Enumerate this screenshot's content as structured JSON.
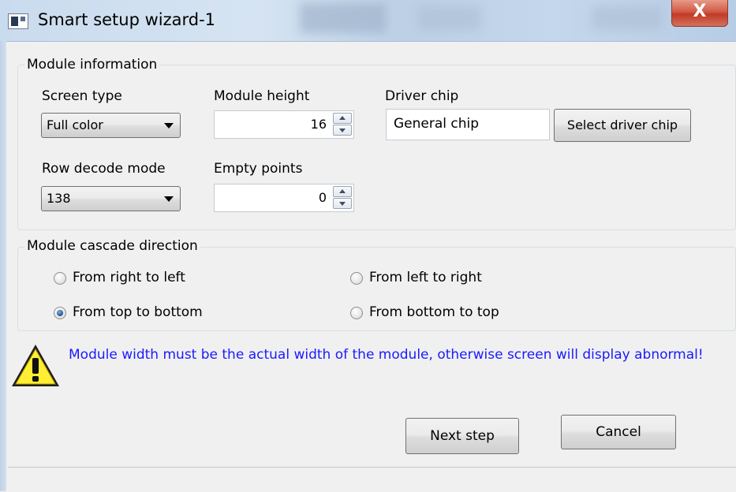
{
  "window": {
    "title": "Smart setup wizard-1",
    "close_glyph": "X"
  },
  "module_info": {
    "legend": "Module information",
    "screen_type": {
      "label": "Screen type",
      "value": "Full color"
    },
    "module_height": {
      "label": "Module height",
      "value": "16"
    },
    "driver_chip": {
      "label": "Driver chip",
      "value": "General chip",
      "select_button": "Select driver chip"
    },
    "row_decode": {
      "label": "Row decode mode",
      "value": "138"
    },
    "empty_points": {
      "label": "Empty points",
      "value": "0"
    }
  },
  "cascade": {
    "legend": "Module cascade direction",
    "options": [
      {
        "label": "From right to left",
        "checked": false
      },
      {
        "label": "From left to right",
        "checked": false
      },
      {
        "label": "From top to bottom",
        "checked": true
      },
      {
        "label": "From bottom to top",
        "checked": false
      }
    ]
  },
  "warning": {
    "icon": "warning-icon",
    "text": "Module width must be the actual width of the module, otherwise screen will display abnormal!",
    "color": "#1a1aff"
  },
  "buttons": {
    "next": "Next step",
    "cancel": "Cancel"
  }
}
